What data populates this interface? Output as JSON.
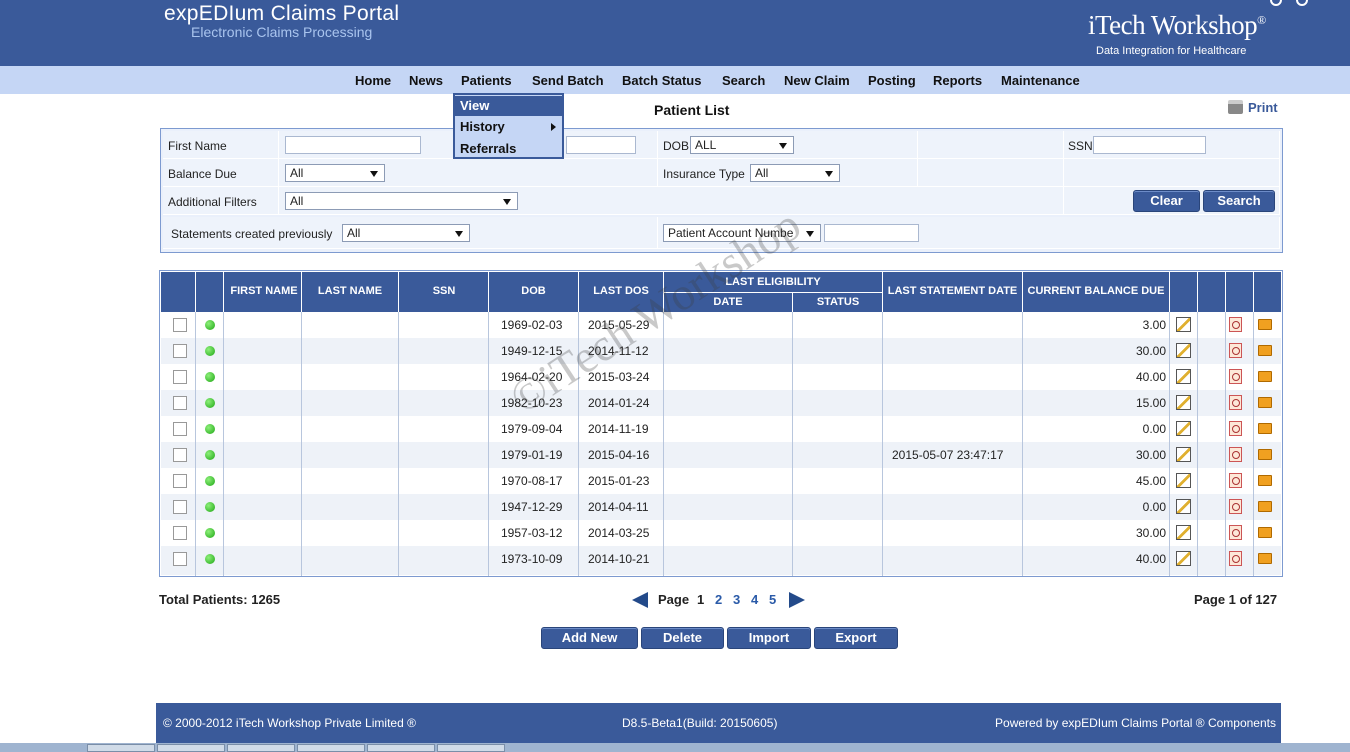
{
  "header": {
    "title": "expEDIum Claims Portal",
    "subtitle": "Electronic Claims Processing",
    "logo_text": "iTech Workshop",
    "logo_reg": "®",
    "logo_tagline": "Data Integration for Healthcare"
  },
  "nav": {
    "items": [
      "Home",
      "News",
      "Patients",
      "Send Batch",
      "Batch Status",
      "Search",
      "New Claim",
      "Posting",
      "Reports",
      "Maintenance"
    ]
  },
  "dropdown": {
    "items": [
      "View",
      "History",
      "Referrals"
    ]
  },
  "page": {
    "title": "Patient List",
    "print_label": "Print"
  },
  "filters": {
    "first_name_label": "First Name",
    "dob_label": "DOB",
    "dob_value": "ALL",
    "ssn_label": "SSN",
    "balance_due_label": "Balance Due",
    "balance_due_value": "All",
    "insurance_type_label": "Insurance Type",
    "insurance_type_value": "All",
    "additional_filters_label": "Additional Filters",
    "additional_filters_value": "All",
    "statements_label": "Statements created previously",
    "statements_value": "All",
    "account_select_value": "Patient Account Numbe",
    "clear_label": "Clear",
    "search_label": "Search"
  },
  "table": {
    "headers": {
      "first_name": "FIRST NAME",
      "last_name": "LAST NAME",
      "ssn": "SSN",
      "dob": "DOB",
      "last_dos": "LAST DOS",
      "last_eligibility": "LAST ELIGIBILITY",
      "date": "DATE",
      "status": "STATUS",
      "last_statement_date": "LAST STATEMENT DATE",
      "current_balance_due": "CURRENT BALANCE DUE"
    },
    "rows": [
      {
        "dob": "1969-02-03",
        "last_dos": "2015-05-29",
        "statement": "",
        "balance": "3.00"
      },
      {
        "dob": "1949-12-15",
        "last_dos": "2014-11-12",
        "statement": "",
        "balance": "30.00"
      },
      {
        "dob": "1964-02-20",
        "last_dos": "2015-03-24",
        "statement": "",
        "balance": "40.00"
      },
      {
        "dob": "1982-10-23",
        "last_dos": "2014-01-24",
        "statement": "",
        "balance": "15.00"
      },
      {
        "dob": "1979-09-04",
        "last_dos": "2014-11-19",
        "statement": "",
        "balance": "0.00"
      },
      {
        "dob": "1979-01-19",
        "last_dos": "2015-04-16",
        "statement": "2015-05-07 23:47:17",
        "balance": "30.00"
      },
      {
        "dob": "1970-08-17",
        "last_dos": "2015-01-23",
        "statement": "",
        "balance": "45.00"
      },
      {
        "dob": "1947-12-29",
        "last_dos": "2014-04-11",
        "statement": "",
        "balance": "0.00"
      },
      {
        "dob": "1957-03-12",
        "last_dos": "2014-03-25",
        "statement": "",
        "balance": "30.00"
      },
      {
        "dob": "1973-10-09",
        "last_dos": "2014-10-21",
        "statement": "",
        "balance": "40.00"
      }
    ],
    "watermark": "©iTech Workshop"
  },
  "pager": {
    "total_label": "Total Patients: 1265",
    "page_label": "Page",
    "pages": [
      "1",
      "2",
      "3",
      "4",
      "5"
    ],
    "page_of": "Page 1 of 127"
  },
  "actions": {
    "add_new": "Add New",
    "delete": "Delete",
    "import": "Import",
    "export": "Export"
  },
  "footer": {
    "copyright": "© 2000-2012 iTech Workshop Private Limited ®",
    "build": "D8.5-Beta1(Build: 20150605)",
    "powered": "Powered by expEDIum Claims Portal ® Components"
  },
  "colors": {
    "primary": "#3a5a9a",
    "nav_bg": "#c5d6f5",
    "status_dot": "#1ea614"
  }
}
